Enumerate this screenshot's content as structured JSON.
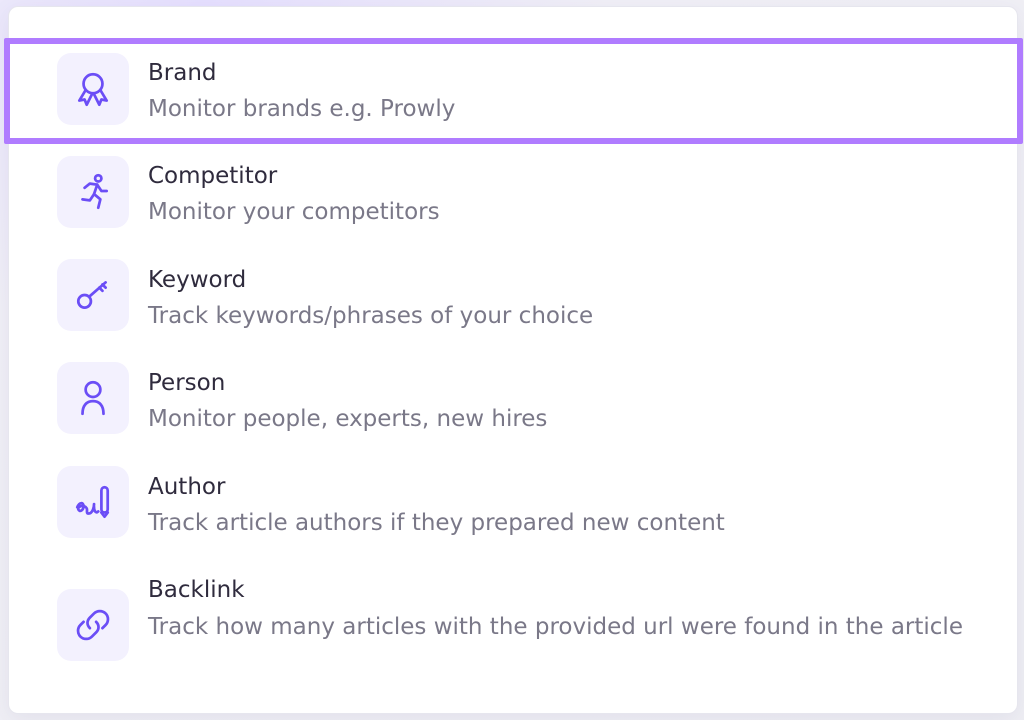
{
  "items": [
    {
      "title": "Brand",
      "description": "Monitor brands e.g. Prowly",
      "icon": "badge-ribbon-icon"
    },
    {
      "title": "Competitor",
      "description": "Monitor your competitors",
      "icon": "running-person-icon"
    },
    {
      "title": "Keyword",
      "description": "Track keywords/phrases of your choice",
      "icon": "key-icon"
    },
    {
      "title": "Person",
      "description": "Monitor people, experts, new hires",
      "icon": "person-icon"
    },
    {
      "title": "Author",
      "description": "Track article authors if they prepared new content",
      "icon": "signature-pen-icon"
    },
    {
      "title": "Backlink",
      "description": "Track how many articles with the provided url were found in the article",
      "icon": "link-icon"
    }
  ],
  "selected_index": 0,
  "colors": {
    "accent": "#6b4ef6",
    "icon_bg": "#f3f1fe",
    "selection_outline": "#b07cff",
    "title": "#2f2b3d",
    "description": "#7a7888"
  }
}
